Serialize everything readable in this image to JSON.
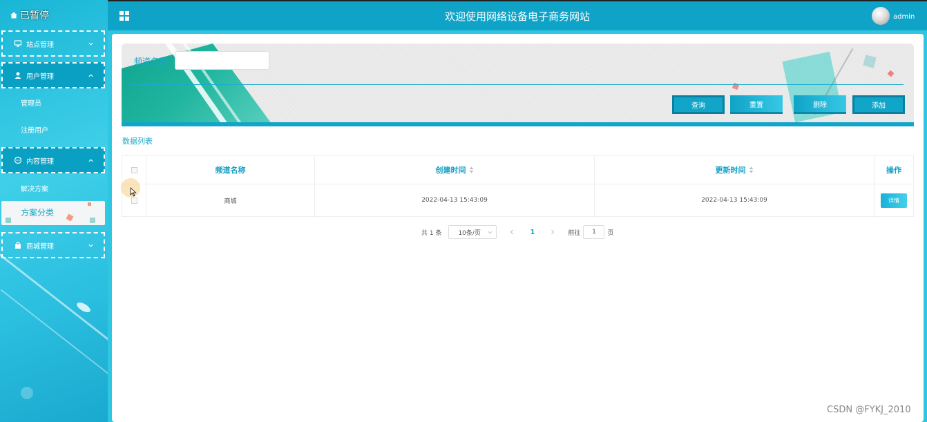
{
  "sidebar": {
    "brand": "已暂停",
    "groups": [
      {
        "label": "站点管理"
      },
      {
        "label": "用户管理",
        "items": [
          "管理员",
          "注册用户"
        ]
      },
      {
        "label": "内容管理",
        "items": [
          "解决方案",
          "方案分类"
        ]
      },
      {
        "label": "商城管理"
      }
    ]
  },
  "header": {
    "title": "欢迎使用网络设备电子商务网站",
    "user": "admin"
  },
  "search": {
    "label": "频道名称",
    "value": "",
    "placeholder": ""
  },
  "buttons": {
    "query": "查询",
    "reset": "重置",
    "delete": "删除",
    "add": "添加"
  },
  "list_title": "数据列表",
  "table": {
    "columns": [
      "频道名称",
      "创建时间",
      "更新时间",
      "操作"
    ],
    "rows": [
      {
        "name": "商城",
        "created": "2022-04-13 15:43:09",
        "updated": "2022-04-13 15:43:09",
        "action": "详情"
      }
    ]
  },
  "pagination": {
    "total": "共 1 条",
    "page_size": "10条/页",
    "current": "1",
    "goto_label": "前往",
    "goto_value": "1",
    "page_suffix": "页"
  },
  "watermark": "CSDN @FYKJ_2010",
  "colors": {
    "accent": "#11a5c8",
    "sidebar": "#2ec6e0"
  }
}
